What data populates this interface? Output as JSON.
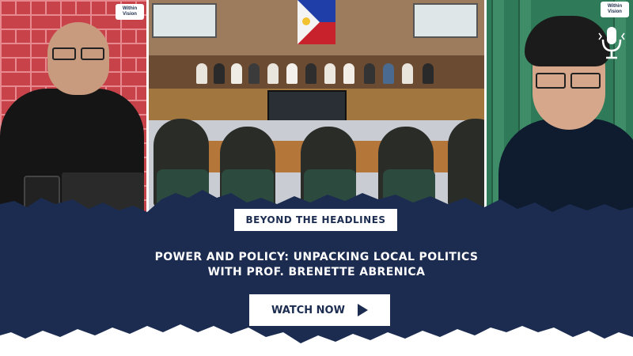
{
  "panels": {
    "left": {
      "logo_text": [
        "Within",
        "Vision"
      ]
    },
    "right": {
      "logo_text": [
        "Within",
        "Vision"
      ]
    }
  },
  "banner": {
    "kicker": "BEYOND THE HEADLINES",
    "title_line1": "POWER AND POLICY: UNPACKING LOCAL POLITICS",
    "title_line2": "WITH PROF. BRENETTE ABRENICA",
    "cta_label": "WATCH NOW"
  },
  "icons": {
    "cta": "play-icon",
    "podcast": "microphone-icon"
  },
  "colors": {
    "banner_navy": "#1b2c50",
    "brick_red": "#c8424a",
    "green_wall": "#2f7a58",
    "text_on_banner": "#ffffff"
  }
}
